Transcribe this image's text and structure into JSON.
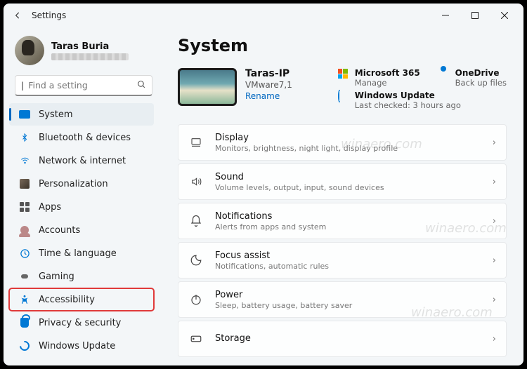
{
  "window": {
    "title": "Settings"
  },
  "user": {
    "name": "Taras Buria"
  },
  "search": {
    "placeholder": "Find a setting"
  },
  "sidebar": {
    "items": [
      {
        "label": "System",
        "icon": "system-icon",
        "selected": true
      },
      {
        "label": "Bluetooth & devices",
        "icon": "bluetooth-icon"
      },
      {
        "label": "Network & internet",
        "icon": "network-icon"
      },
      {
        "label": "Personalization",
        "icon": "personalization-icon"
      },
      {
        "label": "Apps",
        "icon": "apps-icon"
      },
      {
        "label": "Accounts",
        "icon": "accounts-icon"
      },
      {
        "label": "Time & language",
        "icon": "time-language-icon"
      },
      {
        "label": "Gaming",
        "icon": "gaming-icon"
      },
      {
        "label": "Accessibility",
        "icon": "accessibility-icon",
        "highlighted": true
      },
      {
        "label": "Privacy & security",
        "icon": "privacy-icon"
      },
      {
        "label": "Windows Update",
        "icon": "windows-update-icon"
      }
    ]
  },
  "page": {
    "title": "System"
  },
  "device": {
    "name": "Taras-IP",
    "model": "VMware7,1",
    "rename": "Rename"
  },
  "hero_tiles": {
    "m365": {
      "title": "Microsoft 365",
      "sub": "Manage"
    },
    "onedrive": {
      "title": "OneDrive",
      "sub": "Back up files"
    },
    "update": {
      "title": "Windows Update",
      "sub": "Last checked: 3 hours ago"
    }
  },
  "cards": [
    {
      "title": "Display",
      "sub": "Monitors, brightness, night light, display profile",
      "icon": "display-icon"
    },
    {
      "title": "Sound",
      "sub": "Volume levels, output, input, sound devices",
      "icon": "sound-icon"
    },
    {
      "title": "Notifications",
      "sub": "Alerts from apps and system",
      "icon": "notifications-icon"
    },
    {
      "title": "Focus assist",
      "sub": "Notifications, automatic rules",
      "icon": "focus-assist-icon"
    },
    {
      "title": "Power",
      "sub": "Sleep, battery usage, battery saver",
      "icon": "power-icon"
    },
    {
      "title": "Storage",
      "sub": "",
      "icon": "storage-icon"
    }
  ],
  "watermark": "winaero.com"
}
